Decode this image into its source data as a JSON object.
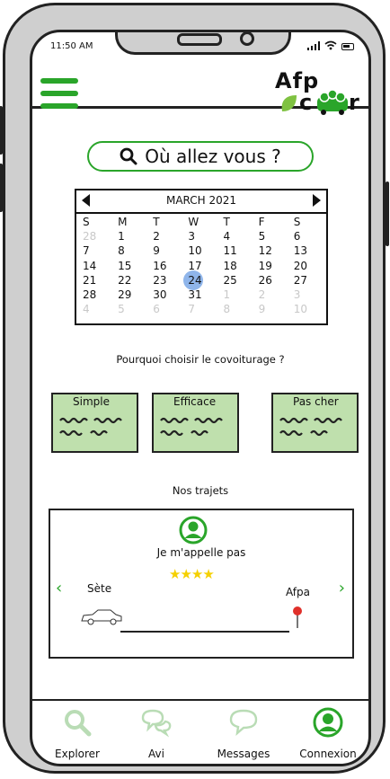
{
  "status_bar": {
    "time": "11:50 AM"
  },
  "header": {
    "menu_icon": "hamburger-icon",
    "logo": {
      "text_top": "Afp",
      "text_bottom_left": "c",
      "text_bottom_right": "r"
    }
  },
  "search": {
    "label": "Où allez vous ?",
    "icon": "search-icon"
  },
  "calendar": {
    "title": "MARCH 2021",
    "weekdays": [
      "S",
      "M",
      "T",
      "W",
      "T",
      "F",
      "S"
    ],
    "weeks": [
      [
        {
          "d": "28",
          "m": true
        },
        {
          "d": "1"
        },
        {
          "d": "2"
        },
        {
          "d": "3"
        },
        {
          "d": "4"
        },
        {
          "d": "5"
        },
        {
          "d": "6"
        }
      ],
      [
        {
          "d": "7"
        },
        {
          "d": "8"
        },
        {
          "d": "9"
        },
        {
          "d": "10"
        },
        {
          "d": "11"
        },
        {
          "d": "12"
        },
        {
          "d": "13"
        }
      ],
      [
        {
          "d": "14"
        },
        {
          "d": "15"
        },
        {
          "d": "16"
        },
        {
          "d": "17"
        },
        {
          "d": "18"
        },
        {
          "d": "19"
        },
        {
          "d": "20"
        }
      ],
      [
        {
          "d": "21"
        },
        {
          "d": "22"
        },
        {
          "d": "23"
        },
        {
          "d": "24",
          "sel": true
        },
        {
          "d": "25"
        },
        {
          "d": "26"
        },
        {
          "d": "27"
        }
      ],
      [
        {
          "d": "28"
        },
        {
          "d": "29"
        },
        {
          "d": "30"
        },
        {
          "d": "31"
        },
        {
          "d": "1",
          "m": true
        },
        {
          "d": "2",
          "m": true
        },
        {
          "d": "3",
          "m": true
        }
      ],
      [
        {
          "d": "4",
          "m": true
        },
        {
          "d": "5",
          "m": true
        },
        {
          "d": "6",
          "m": true
        },
        {
          "d": "7",
          "m": true
        },
        {
          "d": "8",
          "m": true
        },
        {
          "d": "9",
          "m": true
        },
        {
          "d": "10",
          "m": true
        }
      ]
    ]
  },
  "why": {
    "title": "Pourquoi choisir le covoiturage ?",
    "cards": [
      {
        "title": "Simple"
      },
      {
        "title": "Efficace"
      },
      {
        "title": "Pas cher"
      }
    ]
  },
  "trips": {
    "title": "Nos trajets",
    "driver_name": "Je m'appelle pas",
    "rating": 4,
    "rating_max": 5,
    "from": "Sète",
    "to": "Afpa"
  },
  "tabbar": {
    "tabs": [
      {
        "label": "Explorer",
        "icon": "search-icon",
        "active": false
      },
      {
        "label": "Avi",
        "icon": "chat-bubbles-icon",
        "active": false
      },
      {
        "label": "Messages",
        "icon": "chat-bubble-icon",
        "active": false
      },
      {
        "label": "Connexion",
        "icon": "user-icon",
        "active": true
      }
    ]
  },
  "colors": {
    "accent_green": "#2aa52a",
    "light_green": "#bfe0ad",
    "inactive_icon": "#b9dcb5",
    "selected_day": "#8fb5ea",
    "star": "#f5d000",
    "pin": "#e0302a"
  }
}
